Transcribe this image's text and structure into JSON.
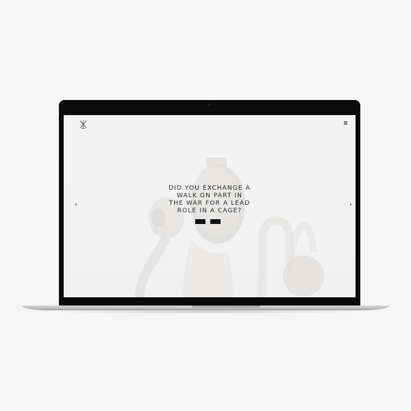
{
  "headline": {
    "lines": [
      "DID YOU EXCHANGE A",
      "WALK ON PART IN",
      "THE WAR FOR A LEAD",
      "ROLE IN A CAGE?"
    ]
  },
  "buttons": {
    "primary_label": "",
    "secondary_label": ""
  },
  "nav": {
    "menu_icon": "≡",
    "prev_icon": "‹",
    "next_icon": "›"
  },
  "colors": {
    "page_background": "#f6f6f6",
    "bezel": "#0b0b0b",
    "screen_background": "#f3f3f3",
    "text": "#2a2a2a",
    "button": "#111111"
  },
  "icons": {
    "logo": "crossed-x-logo-icon",
    "menu": "hamburger-menu-icon",
    "prev": "chevron-left-icon",
    "next": "chevron-right-icon"
  }
}
